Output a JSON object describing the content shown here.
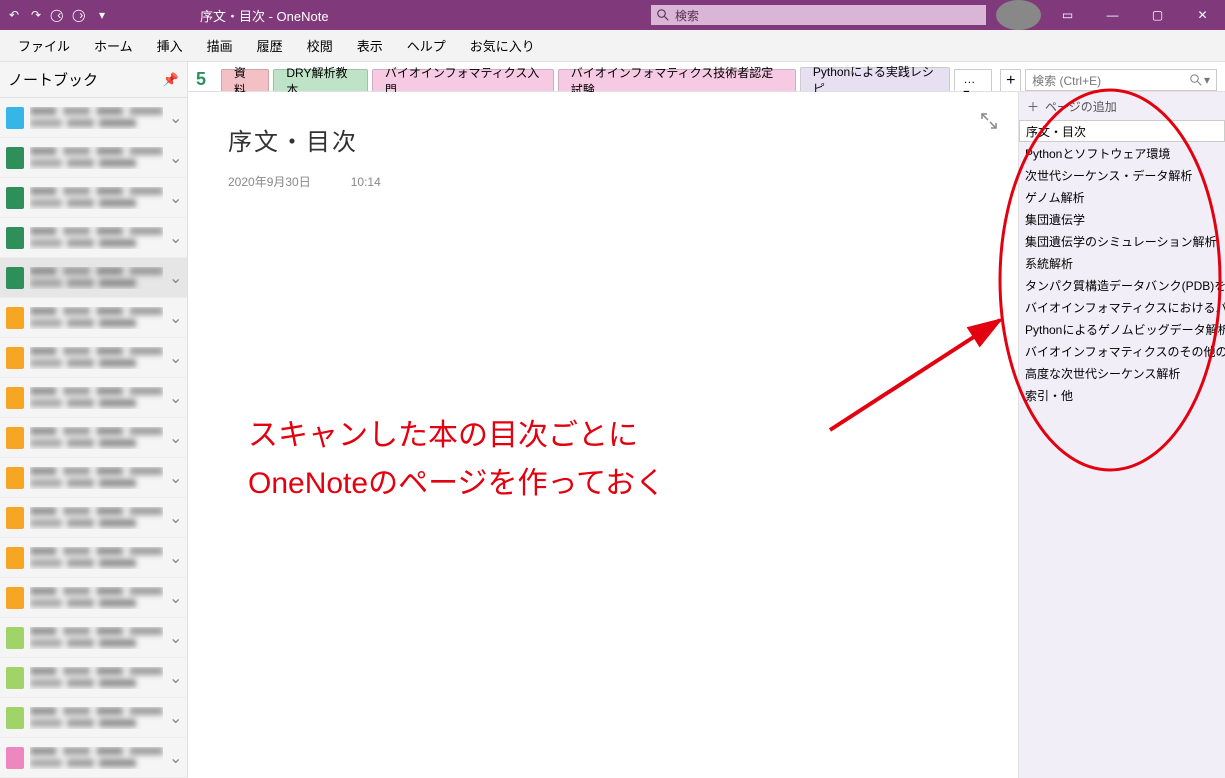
{
  "window": {
    "title": "序文・目次  -  OneNote"
  },
  "search": {
    "titlebar_placeholder": "検索",
    "eastbox_placeholder": "検索 (Ctrl+E)"
  },
  "menu": [
    "ファイル",
    "ホーム",
    "挿入",
    "描画",
    "履歴",
    "校閲",
    "表示",
    "ヘルプ",
    "お気に入り"
  ],
  "sidebar": {
    "title": "ノートブック"
  },
  "notebooks": [
    {
      "color": "#35B6E6",
      "selected": false
    },
    {
      "color": "#2F8F5B",
      "selected": false
    },
    {
      "color": "#2F8F5B",
      "selected": false
    },
    {
      "color": "#2F8F5B",
      "selected": false
    },
    {
      "color": "#2F8F5B",
      "selected": true
    },
    {
      "color": "#F6A623",
      "selected": false
    },
    {
      "color": "#F6A623",
      "selected": false
    },
    {
      "color": "#F6A623",
      "selected": false
    },
    {
      "color": "#F6A623",
      "selected": false
    },
    {
      "color": "#F6A623",
      "selected": false
    },
    {
      "color": "#F6A623",
      "selected": false
    },
    {
      "color": "#F6A623",
      "selected": false
    },
    {
      "color": "#F6A623",
      "selected": false
    },
    {
      "color": "#A0D468",
      "selected": false
    },
    {
      "color": "#A0D468",
      "selected": false
    },
    {
      "color": "#A0D468",
      "selected": false
    },
    {
      "color": "#EC87C0",
      "selected": false
    }
  ],
  "section_tabs": [
    {
      "label": "資料",
      "cls": "tab-c-red"
    },
    {
      "label": "DRY解析教本",
      "cls": "tab-c-green"
    },
    {
      "label": "バイオインフォマティクス入門",
      "cls": "tab-c-pink"
    },
    {
      "label": "バイオインフォマティクス技術者認定試験",
      "cls": "tab-c-pink2"
    },
    {
      "label": "Pythonによる実践レシピ",
      "cls": "tab-c-lilac",
      "active": true
    }
  ],
  "tab_more_label": "…",
  "page": {
    "title": "序文・目次",
    "date": "2020年9月30日",
    "time": "10:14"
  },
  "add_page_label": "ページの追加",
  "pages": [
    "序文・目次",
    "Pythonとソフトウェア環境",
    "次世代シーケンス・データ解析",
    "ゲノム解析",
    "集団遺伝学",
    "集団遺伝学のシミュレーション解析",
    "系統解析",
    "タンパク質構造データバンク(PDB)を使",
    "バイオインフォマティクスにおけるパイプライ",
    "Pythonによるゲノムビッグデータ解析",
    "バイオインフォマティクスのその他のトピック",
    "高度な次世代シーケンス解析",
    "索引・他"
  ],
  "annotation": {
    "line1": "スキャンした本の目次ごとに",
    "line2": "OneNoteのページを作っておく"
  }
}
